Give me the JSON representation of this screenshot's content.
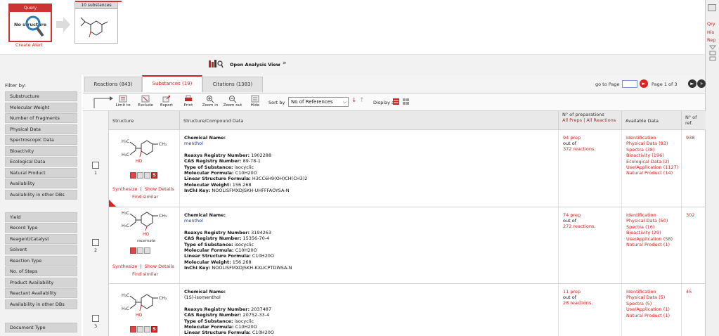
{
  "header": {
    "query_title": "Query",
    "query_text": "No structure",
    "create_alert": "Create Alert",
    "substances_box_title": "10 substances"
  },
  "right_strip": {
    "links": [
      "Qry",
      "His",
      "Rep"
    ]
  },
  "analysis": {
    "button_label": "Open Analysis View"
  },
  "filters": {
    "label": "Filter by:",
    "group1": [
      "Substructure",
      "Molecular Weight",
      "Number of Fragments",
      "Physical Data",
      "Spectroscopic Data",
      "Bioactivity",
      "Ecological Data",
      "Natural Product",
      "Availability",
      "Availability in other DBs"
    ],
    "group2": [
      "Yield",
      "Record Type",
      "Reagent/Catalyst",
      "Solvent",
      "Reaction Type",
      "No. of Steps",
      "Product Availability",
      "Reactant Availability",
      "Availability in other DBs"
    ],
    "group3": [
      "Document Type"
    ]
  },
  "tabs": [
    {
      "label": "Reactions",
      "count": "(843)"
    },
    {
      "label": "Substances",
      "count": "(19)"
    },
    {
      "label": "Citations",
      "count": "(1383)"
    }
  ],
  "pager": {
    "goto_label": "go to Page",
    "page_label": "Page",
    "current": "1",
    "of_label": "of",
    "total": "3"
  },
  "toolbar": {
    "buttons": [
      "Limit to",
      "Exclude",
      "Export",
      "Print",
      "Zoom in",
      "Zoom out",
      "Hide"
    ],
    "sort_label": "Sort by",
    "sort_value": "No of References",
    "display_label": "Display as:"
  },
  "table": {
    "headers": {
      "structure": "Structure",
      "data": "Structure/Compound Data",
      "prep_title": "N° of preparations",
      "prep_all": "All Preps",
      "prep_sep": "|",
      "prep_all_reactions": "All Reactions",
      "available": "Available Data",
      "nref": "N° of ref."
    },
    "rows": [
      {
        "num": "1",
        "racemate": "",
        "links": {
          "synthesize": "Synthesize",
          "show_details": "Show Details",
          "find_similar": "Find similar"
        },
        "chem_name_label": "Chemical Name:",
        "chem_name": "menthol",
        "reaxys_label": "Reaxys Registry Number:",
        "reaxys": "1902288",
        "cas_label": "CAS Registry Number:",
        "cas": "89-78-1",
        "type_label": "Type of Substance:",
        "type": "isocyclic",
        "mf_label": "Molecular Formula:",
        "mf": "C10H20O",
        "lsf_label": "Linear Structure Formula:",
        "lsf": "H3CC6H9(OH)CH(CH3)2",
        "mw_label": "Molecular Weight:",
        "mw": "156.268",
        "inchi_label": "InChI Key:",
        "inchi": "NOOLISFMXDJSKH-UHFFFAOYSA-N",
        "prep": "94 prep",
        "outof": "out of",
        "reactions": "372 reactions.",
        "available": [
          "Identification",
          "Physical Data (93)",
          "Spectra (38)",
          "Bioactivity (196)",
          "Ecological Data (2)",
          "Use/Application (1127)",
          "Natural Product (14)"
        ],
        "nref": "938"
      },
      {
        "num": "2",
        "racemate": "racemate",
        "links": {
          "synthesize": "Synthesize",
          "show_details": "Show Details",
          "find_similar": "Find similar"
        },
        "chem_name_label": "Chemical Name:",
        "chem_name": "menthol",
        "reaxys_label": "Reaxys Registry Number:",
        "reaxys": "3194263",
        "cas_label": "CAS Registry Number:",
        "cas": "15356-70-4",
        "type_label": "Type of Substance:",
        "type": "isocyclic",
        "mf_label": "Molecular Formula:",
        "mf": "C10H20O",
        "lsf_label": "Linear Structure Formula:",
        "lsf": "C10H20O",
        "mw_label": "Molecular Weight:",
        "mw": "156.268",
        "inchi_label": "InChI Key:",
        "inchi": "NOOLISFMXDJSKH-KXUCPTDWSA-N",
        "prep": "74 prep",
        "outof": "out of",
        "reactions": "272 reactions.",
        "available": [
          "Identification",
          "Physical Data (50)",
          "Spectra (16)",
          "Bioactivity (29)",
          "Use/Application (58)",
          "Natural Product (1)"
        ],
        "nref": "302"
      },
      {
        "num": "3",
        "racemate": "",
        "links": {
          "synthesize": "",
          "show_details": "",
          "find_similar": ""
        },
        "chem_name_label": "Chemical Name:",
        "chem_name": "(1S)-isomenthol",
        "reaxys_label": "Reaxys Registry Number:",
        "reaxys": "2037487",
        "cas_label": "CAS Registry Number:",
        "cas": "20752-33-4",
        "type_label": "Type of Substance:",
        "type": "isocyclic",
        "mf_label": "Molecular Formula:",
        "mf": "C10H20O",
        "lsf_label": "Linear Structure Formula:",
        "lsf": "C10H20O",
        "mw_label": "",
        "mw": "",
        "inchi_label": "",
        "inchi": "",
        "prep": "11 prep",
        "outof": "out of",
        "reactions": "28 reactions.",
        "available": [
          "Identification",
          "Physical Data (5)",
          "Spectra (5)",
          "Use/Application (1)",
          "Natural Product (1)"
        ],
        "nref": "45"
      }
    ]
  },
  "colors": {
    "accent": "#cc2222",
    "link_blue": "#1133aa",
    "panel_gray": "#f2f2f2"
  }
}
